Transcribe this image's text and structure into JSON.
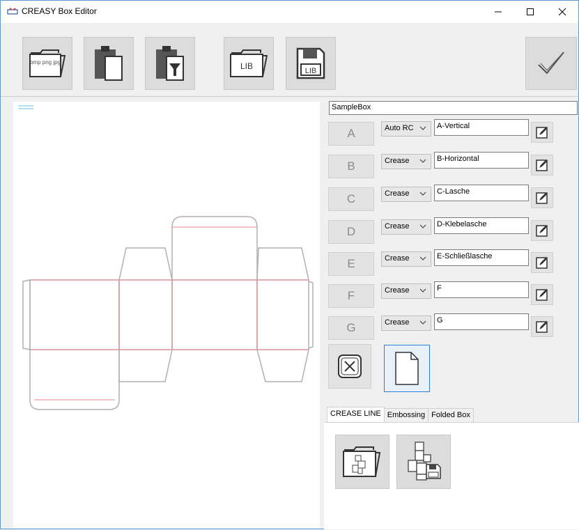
{
  "window": {
    "title": "CREASY Box Editor"
  },
  "toolbar": {
    "import_image_label": "bmp png jpg",
    "lib_open_label": "LIB",
    "lib_save_label": "LIB"
  },
  "box": {
    "name": "SampleBox"
  },
  "rows": [
    {
      "letter": "A",
      "type": "Auto RC",
      "label": "A-Vertical"
    },
    {
      "letter": "B",
      "type": "Crease",
      "label": "B-Horizontal"
    },
    {
      "letter": "C",
      "type": "Crease",
      "label": "C-Lasche"
    },
    {
      "letter": "D",
      "type": "Crease",
      "label": "D-Klebelasche"
    },
    {
      "letter": "E",
      "type": "Crease",
      "label": "E-Schließlasche"
    },
    {
      "letter": "F",
      "type": "Crease",
      "label": "F"
    },
    {
      "letter": "G",
      "type": "Crease",
      "label": "G"
    }
  ],
  "tabs": [
    {
      "label": "CREASE LINE",
      "active": true
    },
    {
      "label": "Embossing",
      "active": false
    },
    {
      "label": "Folded Box",
      "active": false
    }
  ],
  "colors": {
    "crease_line": "#e88a8a",
    "outline": "#a8a8a8",
    "accent": "#9fd3e8"
  }
}
